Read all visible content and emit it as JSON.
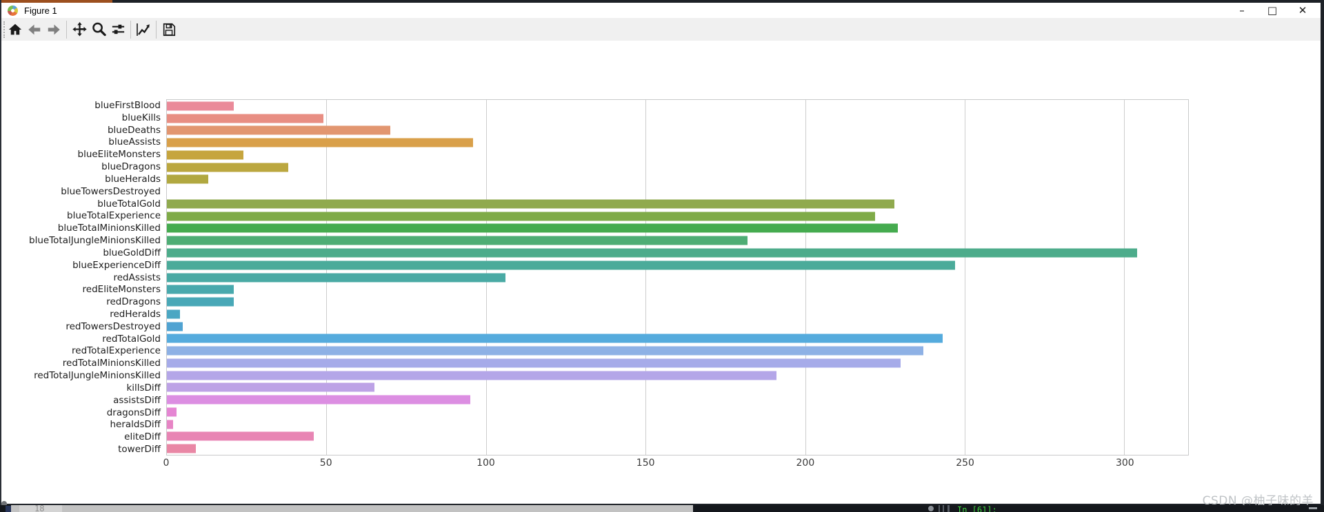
{
  "window": {
    "title": "Figure 1",
    "controls": {
      "minimize": "–",
      "maximize": "□",
      "close": "✕"
    }
  },
  "toolbar": {
    "icons": [
      "home",
      "back",
      "forward",
      "pan",
      "zoom-to-rect",
      "configure-subplots",
      "edit-curves",
      "save"
    ]
  },
  "chart_data": {
    "type": "bar",
    "orientation": "horizontal",
    "title": "",
    "xlabel": "",
    "ylabel": "",
    "grid": "vertical-gridlines",
    "xlim": [
      0,
      320
    ],
    "xticks": [
      0,
      50,
      100,
      150,
      200,
      250,
      300
    ],
    "categories": [
      "blueFirstBlood",
      "blueKills",
      "blueDeaths",
      "blueAssists",
      "blueEliteMonsters",
      "blueDragons",
      "blueHeralds",
      "blueTowersDestroyed",
      "blueTotalGold",
      "blueTotalExperience",
      "blueTotalMinionsKilled",
      "blueTotalJungleMinionsKilled",
      "blueGoldDiff",
      "blueExperienceDiff",
      "redAssists",
      "redEliteMonsters",
      "redDragons",
      "redHeralds",
      "redTowersDestroyed",
      "redTotalGold",
      "redTotalExperience",
      "redTotalMinionsKilled",
      "redTotalJungleMinionsKilled",
      "killsDiff",
      "assistsDiff",
      "dragonsDiff",
      "heraldsDiff",
      "eliteDiff",
      "towerDiff"
    ],
    "values": [
      21,
      49,
      70,
      96,
      24,
      38,
      13,
      0,
      228,
      222,
      229,
      182,
      304,
      247,
      106,
      21,
      21,
      4,
      5,
      243,
      237,
      230,
      191,
      65,
      95,
      3,
      2,
      46,
      9
    ],
    "colors": [
      "#ea8a99",
      "#e88e83",
      "#e29670",
      "#d9a04a",
      "#c6a53e",
      "#bba73f",
      "#b1a840",
      "#a7a941",
      "#90aa4e",
      "#7fab48",
      "#45ab4f",
      "#4ead75",
      "#4dac8b",
      "#4bab9a",
      "#49aaa4",
      "#48a9ad",
      "#49a8b7",
      "#4ba7c3",
      "#50a3d2",
      "#55abdd",
      "#8eb1e5",
      "#a6abe9",
      "#b4a6e8",
      "#bda2e6",
      "#dc8ee2",
      "#e586d3",
      "#e785c5",
      "#e885b4",
      "#e987a5"
    ]
  },
  "watermark": "CSDN @柚子味的羊",
  "statusbar": {
    "editor_line_number": "18",
    "console_prompt": "In [61]:"
  }
}
